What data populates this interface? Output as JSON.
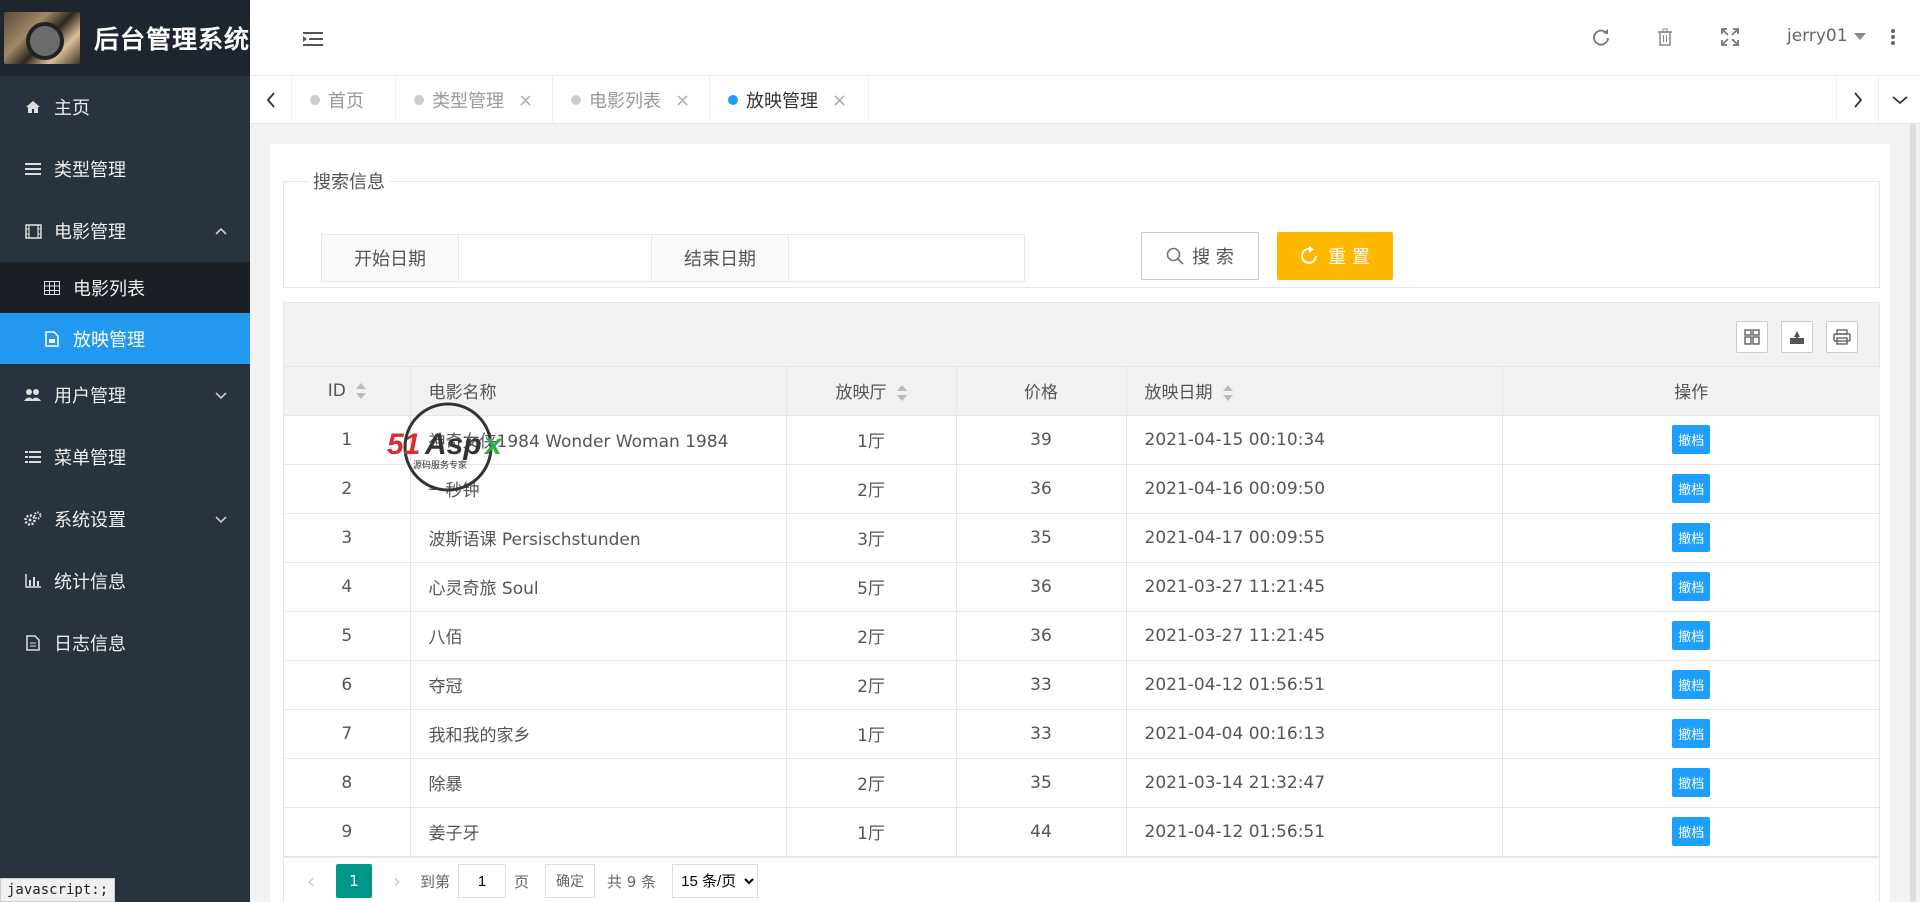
{
  "app": {
    "title": "后台管理系统"
  },
  "sidebar": {
    "items": [
      {
        "label": "主页",
        "icon": "home-icon"
      },
      {
        "label": "类型管理",
        "icon": "list-icon"
      },
      {
        "label": "电影管理",
        "icon": "film-icon"
      },
      {
        "label": "用户管理",
        "icon": "users-icon"
      },
      {
        "label": "菜单管理",
        "icon": "list-icon"
      },
      {
        "label": "系统设置",
        "icon": "gears-icon"
      },
      {
        "label": "统计信息",
        "icon": "bar-chart-icon"
      },
      {
        "label": "日志信息",
        "icon": "file-icon"
      }
    ],
    "sub_items": [
      {
        "label": "电影列表",
        "icon": "table-icon"
      },
      {
        "label": "放映管理",
        "icon": "file-image-icon"
      }
    ]
  },
  "header": {
    "user": "jerry01"
  },
  "tabs": [
    {
      "label": "首页"
    },
    {
      "label": "类型管理"
    },
    {
      "label": "电影列表"
    },
    {
      "label": "放映管理"
    }
  ],
  "search": {
    "legend": "搜索信息",
    "start_label": "开始日期",
    "end_label": "结束日期",
    "search_btn": "搜 索",
    "reset_btn": "重 置"
  },
  "table": {
    "columns": [
      "ID",
      "电影名称",
      "放映厅",
      "价格",
      "放映日期",
      "操作"
    ],
    "rows": [
      {
        "id": "1",
        "name": "神奇女侠1984 Wonder Woman 1984",
        "hall": "1厅",
        "price": "39",
        "date": "2021-04-15 00:10:34",
        "action": "撤档"
      },
      {
        "id": "2",
        "name": "一秒钟",
        "hall": "2厅",
        "price": "36",
        "date": "2021-04-16 00:09:50",
        "action": "撤档"
      },
      {
        "id": "3",
        "name": "波斯语课 Persischstunden",
        "hall": "3厅",
        "price": "35",
        "date": "2021-04-17 00:09:55",
        "action": "撤档"
      },
      {
        "id": "4",
        "name": "心灵奇旅 Soul",
        "hall": "5厅",
        "price": "36",
        "date": "2021-03-27 11:21:45",
        "action": "撤档"
      },
      {
        "id": "5",
        "name": "八佰",
        "hall": "2厅",
        "price": "36",
        "date": "2021-03-27 11:21:45",
        "action": "撤档"
      },
      {
        "id": "6",
        "name": "夺冠",
        "hall": "2厅",
        "price": "33",
        "date": "2021-04-12 01:56:51",
        "action": "撤档"
      },
      {
        "id": "7",
        "name": "我和我的家乡",
        "hall": "1厅",
        "price": "33",
        "date": "2021-04-04 00:16:13",
        "action": "撤档"
      },
      {
        "id": "8",
        "name": "除暴",
        "hall": "2厅",
        "price": "35",
        "date": "2021-03-14 21:32:47",
        "action": "撤档"
      },
      {
        "id": "9",
        "name": "姜子牙",
        "hall": "1厅",
        "price": "44",
        "date": "2021-04-12 01:56:51",
        "action": "撤档"
      }
    ]
  },
  "pager": {
    "current": "1",
    "goto_label": "到第",
    "goto_value": "1",
    "page_label": "页",
    "confirm": "确定",
    "total": "共 9 条",
    "page_size": "15 条/页"
  },
  "status_tip": "javascript:;",
  "watermark": "51Aspx 源码服务专家",
  "colors": {
    "sidebar": "#28333e",
    "active": "#2299ee",
    "reset": "#ffb800",
    "pager_current": "#009688",
    "action": "#1e9fff"
  }
}
